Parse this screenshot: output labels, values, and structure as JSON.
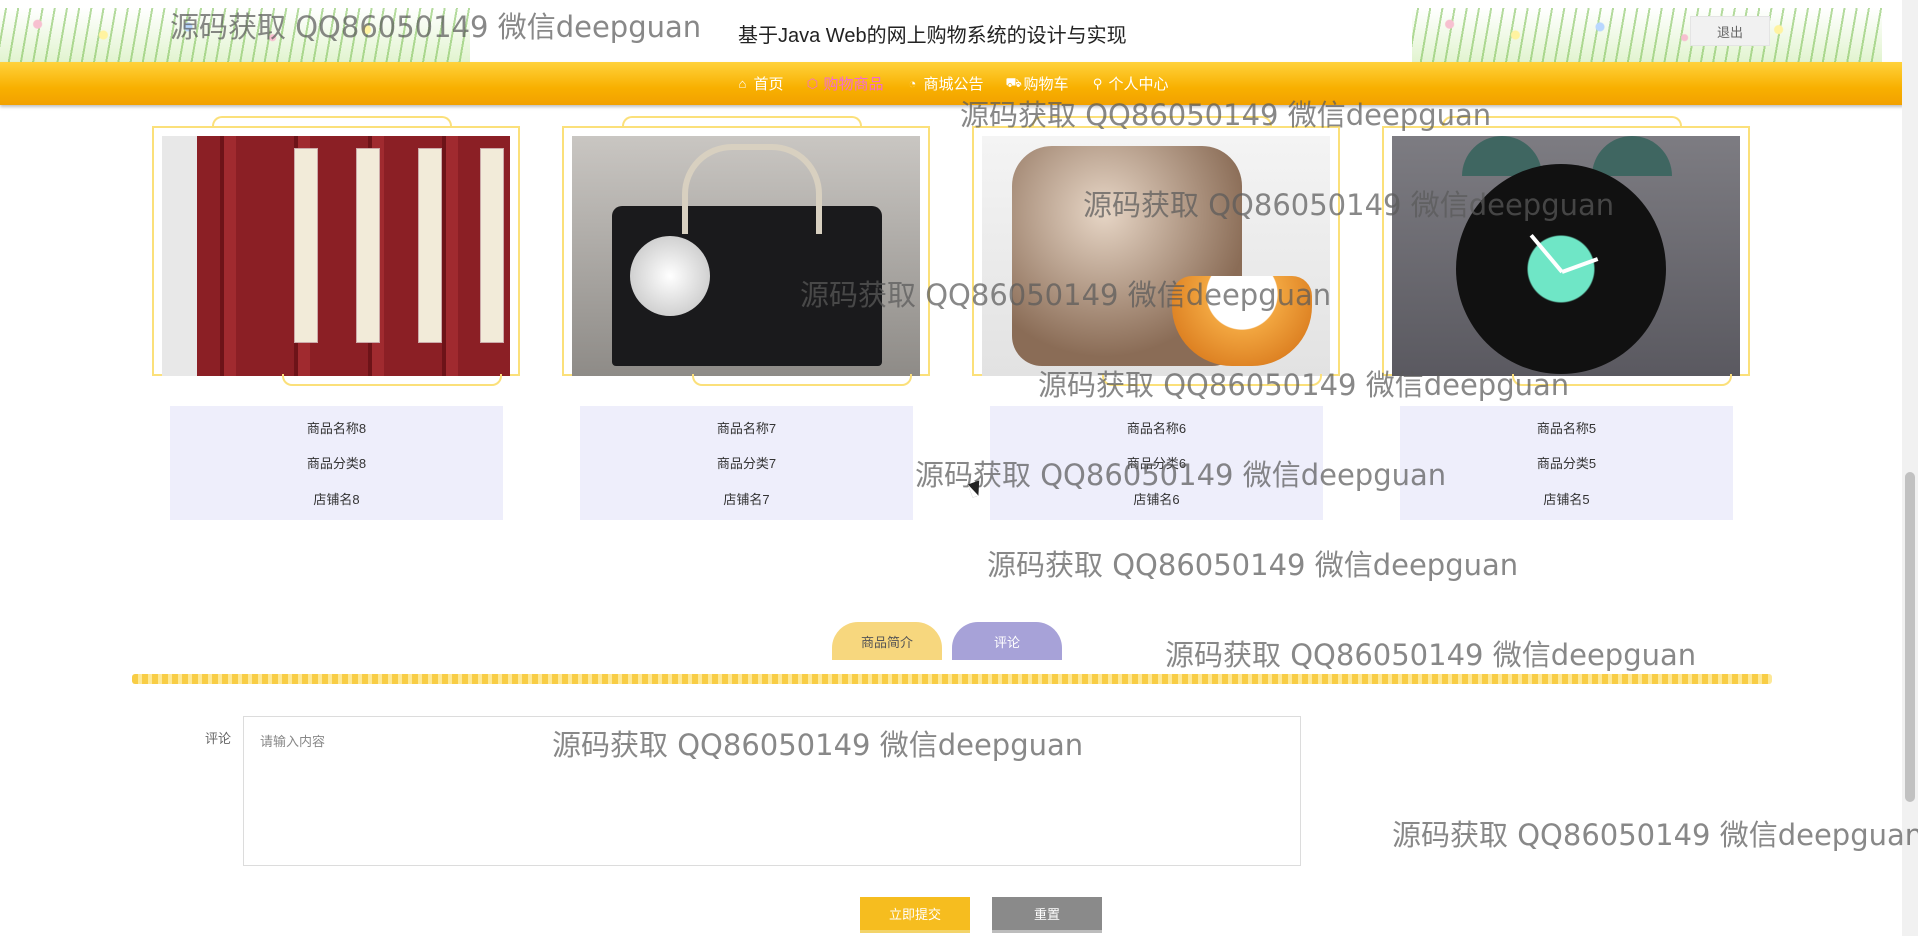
{
  "header": {
    "site_title": "基于Java Web的网上购物系统的设计与实现",
    "logout_label": "退出"
  },
  "nav": {
    "items": [
      {
        "label": "首页",
        "icon": "home-icon"
      },
      {
        "label": "购物商品",
        "icon": "box-icon"
      },
      {
        "label": "商城公告",
        "icon": "notice-icon"
      },
      {
        "label": "购物车",
        "icon": "cart-icon"
      },
      {
        "label": "个人中心",
        "icon": "user-icon"
      }
    ],
    "active_index": 1
  },
  "products": [
    {
      "name": "商品名称8",
      "category": "商品分类8",
      "shop": "店铺名8",
      "image": "red-book-set-photo"
    },
    {
      "name": "商品名称7",
      "category": "商品分类7",
      "shop": "店铺名7",
      "image": "black-handbag-photo"
    },
    {
      "name": "商品名称6",
      "category": "商品分类6",
      "shop": "店铺名6",
      "image": "rice-cooker-photo"
    },
    {
      "name": "商品名称5",
      "category": "商品分类5",
      "shop": "店铺名5",
      "image": "alarm-clock-photo"
    }
  ],
  "tabs": {
    "intro_label": "商品简介",
    "comment_label": "评论"
  },
  "comment_form": {
    "label": "评论",
    "placeholder": "请输入内容",
    "value": "",
    "submit_label": "立即提交",
    "reset_label": "重置"
  },
  "watermark": {
    "text": "源码获取 QQ86050149 微信deepguan"
  },
  "colors": {
    "nav_bg": "#f8b000",
    "nav_active": "#f36bd0",
    "info_bg": "#eeeefb",
    "frame_border": "#fbe07a",
    "tab_intro": "#f7d77e",
    "tab_comment": "#a7a2d8",
    "submit_bg": "#f6bd1f",
    "reset_bg": "#8a8a8a"
  }
}
